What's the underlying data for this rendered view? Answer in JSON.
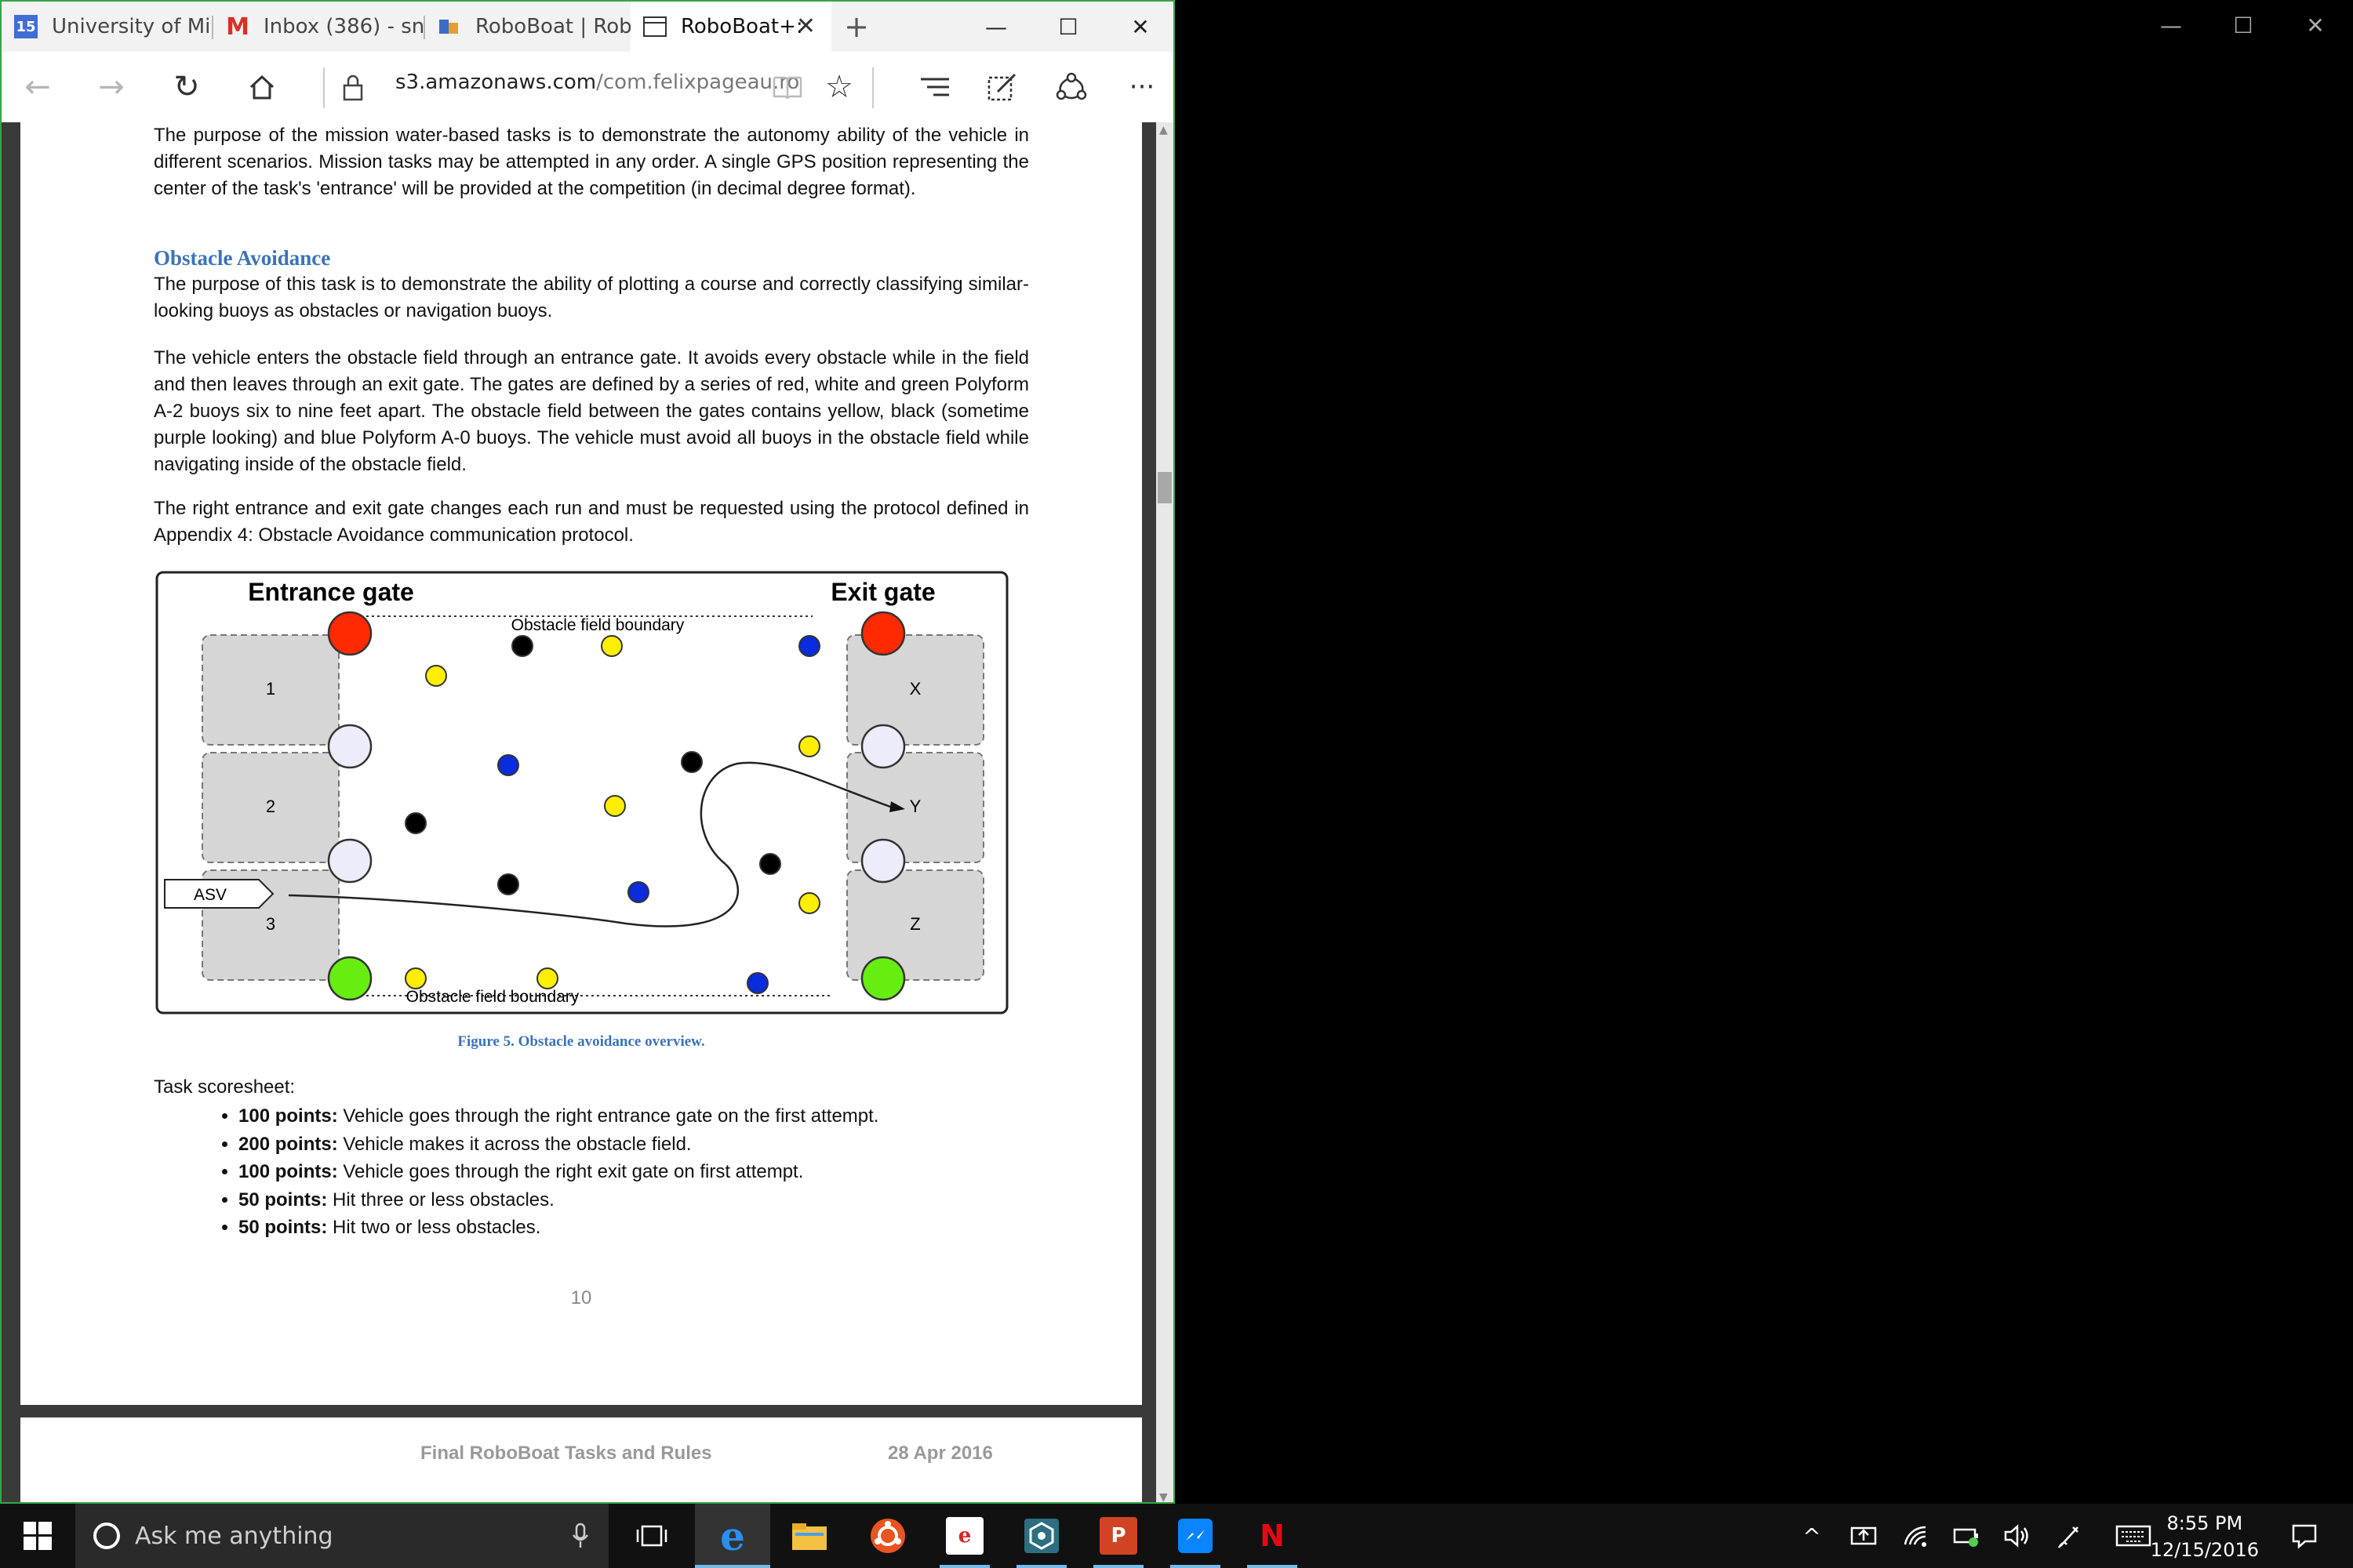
{
  "browser": {
    "tabs": [
      {
        "label": "University of Mi",
        "icon": "calendar-icon"
      },
      {
        "label": "Inbox (386) - sn",
        "icon": "gmail-icon"
      },
      {
        "label": "RoboBoat | Rob",
        "icon": "roboboat-icon"
      },
      {
        "label": "RoboBoat+:",
        "icon": "page-icon",
        "active": true
      }
    ],
    "calendar_badge": "15",
    "new_tab": "+",
    "window_controls": {
      "minimize": "—",
      "maximize": "☐",
      "close": "✕"
    },
    "url_domain": "s3.amazonaws.com",
    "url_path": "/com.felixpageau.ro"
  },
  "document": {
    "intro": "The purpose of the mission water-based tasks is to demonstrate the autonomy ability of the vehicle in different scenarios. Mission tasks may be attempted in any order. A single GPS position representing the center of the task's 'entrance' will be provided at the competition (in decimal degree format).",
    "heading": "Obstacle Avoidance",
    "p1": "The purpose of this task is to demonstrate the ability of plotting a course and correctly classifying similar-looking buoys as obstacles or navigation buoys.",
    "p2": "The vehicle enters the obstacle field through an entrance gate. It avoids every obstacle while in the field and then leaves through an exit gate. The gates are defined by a series of red, white and green Polyform A-2 buoys six to nine feet apart. The obstacle field between the gates contains yellow, black (sometime purple looking) and blue Polyform A-0 buoys. The vehicle must avoid all buoys in the obstacle field while navigating inside of the obstacle field.",
    "p3": "The right entrance and exit gate changes each run and must be requested using the protocol defined in Appendix 4: Obstacle Avoidance communication protocol.",
    "figure": {
      "entrance_label": "Entrance gate",
      "exit_label": "Exit gate",
      "boundary_top": "Obstacle field boundary",
      "boundary_bottom": "Obstacle field boundary",
      "entrance_slots": [
        "1",
        "2",
        "3"
      ],
      "exit_slots": [
        "X",
        "Y",
        "Z"
      ],
      "vehicle_label": "ASV",
      "caption": "Figure 5.  Obstacle avoidance overview.",
      "colors": {
        "red": "#ff2a00",
        "white": "#ececfa",
        "green": "#66ee11",
        "yellow": "#ffee00",
        "black": "#000000",
        "blue": "#0a2cdd"
      }
    },
    "scoresheet_title": "Task scoresheet:",
    "scores": [
      {
        "points": "100 points:",
        "text": " Vehicle goes through the right entrance gate on the first attempt."
      },
      {
        "points": "200 points:",
        "text": " Vehicle makes it across the obstacle field."
      },
      {
        "points": "100 points:",
        "text": " Vehicle goes through the right exit gate on first attempt."
      },
      {
        "points": "50 points:",
        "text": " Hit three or less obstacles."
      },
      {
        "points": "50 points:",
        "text": " Hit two or less obstacles."
      }
    ],
    "page_number": "10",
    "next_footer_left": "Final RoboBoat Tasks and Rules",
    "next_footer_right": "28 Apr 2016"
  },
  "taskbar": {
    "search_placeholder": "Ask me anything",
    "time": "8:55 PM",
    "date": "12/15/2016"
  },
  "desktop_window_controls": {
    "minimize": "—",
    "maximize": "☐",
    "close": "✕"
  }
}
